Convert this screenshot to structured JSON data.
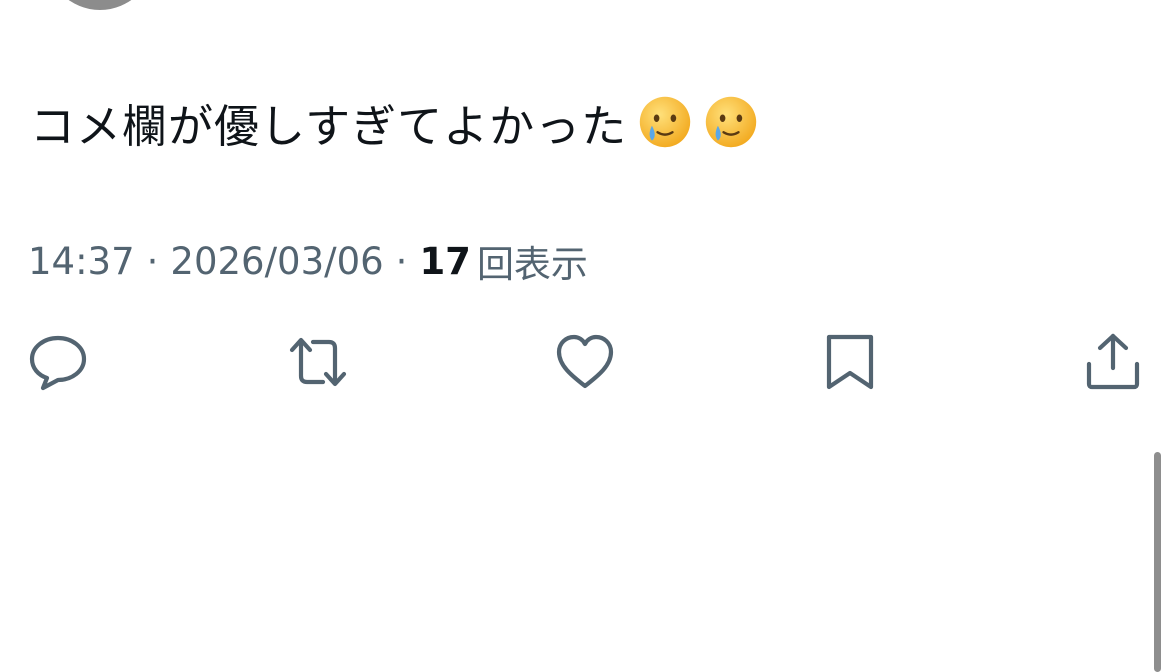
{
  "tweet": {
    "text": "コメ欄が優しすぎてよかった",
    "emojis": [
      "face-holding-back-tears-emoji",
      "face-holding-back-tears-emoji"
    ]
  },
  "meta": {
    "time": "14:37",
    "separator": "·",
    "date": "2026/03/06",
    "views_count": "17",
    "views_label": "回表示"
  },
  "actions": [
    {
      "icon": "reply-icon"
    },
    {
      "icon": "retweet-icon"
    },
    {
      "icon": "like-icon"
    },
    {
      "icon": "bookmark-icon"
    },
    {
      "icon": "share-icon"
    }
  ],
  "colors": {
    "text": "#0f1419",
    "secondary": "#536471",
    "icon": "#536471",
    "emoji_face": "#f7c23b",
    "emoji_tear": "#5aa7e8"
  }
}
